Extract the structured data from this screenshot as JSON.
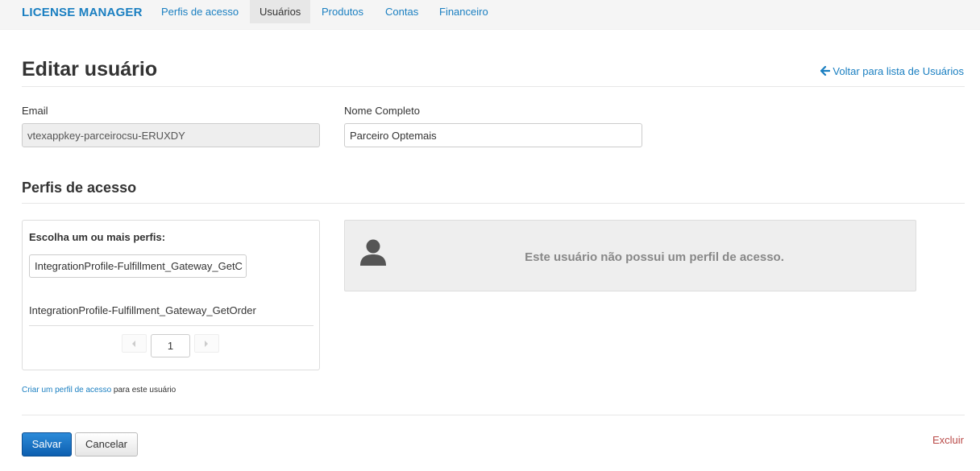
{
  "navbar": {
    "brand": "LICENSE MANAGER",
    "items": [
      {
        "label": "Perfis de acesso",
        "active": false
      },
      {
        "label": "Usuários",
        "active": true
      },
      {
        "label": "Produtos",
        "active": false
      },
      {
        "label": "Contas",
        "active": false
      },
      {
        "label": "Financeiro",
        "active": false
      }
    ]
  },
  "header": {
    "title": "Editar usuário",
    "back_link": "Voltar para lista de Usuários"
  },
  "form": {
    "email_label": "Email",
    "email_value": "vtexappkey-parceirocsu-ERUXDY",
    "name_label": "Nome Completo",
    "name_value": "Parceiro Optemais"
  },
  "profiles": {
    "section_title": "Perfis de acesso",
    "choose_label": "Escolha um ou mais perfis:",
    "search_value": "IntegrationProfile-Fulfillment_Gateway_GetC",
    "options": [
      "IntegrationProfile-Fulfillment_Gateway_GetOrder"
    ],
    "page": "1",
    "empty_message": "Este usuário não possui um perfil de acesso.",
    "create_link": "Criar um perfil de acesso",
    "create_suffix": " para este usuário"
  },
  "actions": {
    "save": "Salvar",
    "cancel": "Cancelar",
    "delete": "Excluir"
  },
  "colors": {
    "link": "#1a7fc1",
    "primary": "#1a73c7",
    "danger": "#b94a48",
    "empty_bg": "#eeeeee"
  },
  "icons": {
    "back": "arrow-left-icon",
    "avatar": "user-icon",
    "prev": "chevron-left-icon",
    "next": "chevron-right-icon"
  }
}
